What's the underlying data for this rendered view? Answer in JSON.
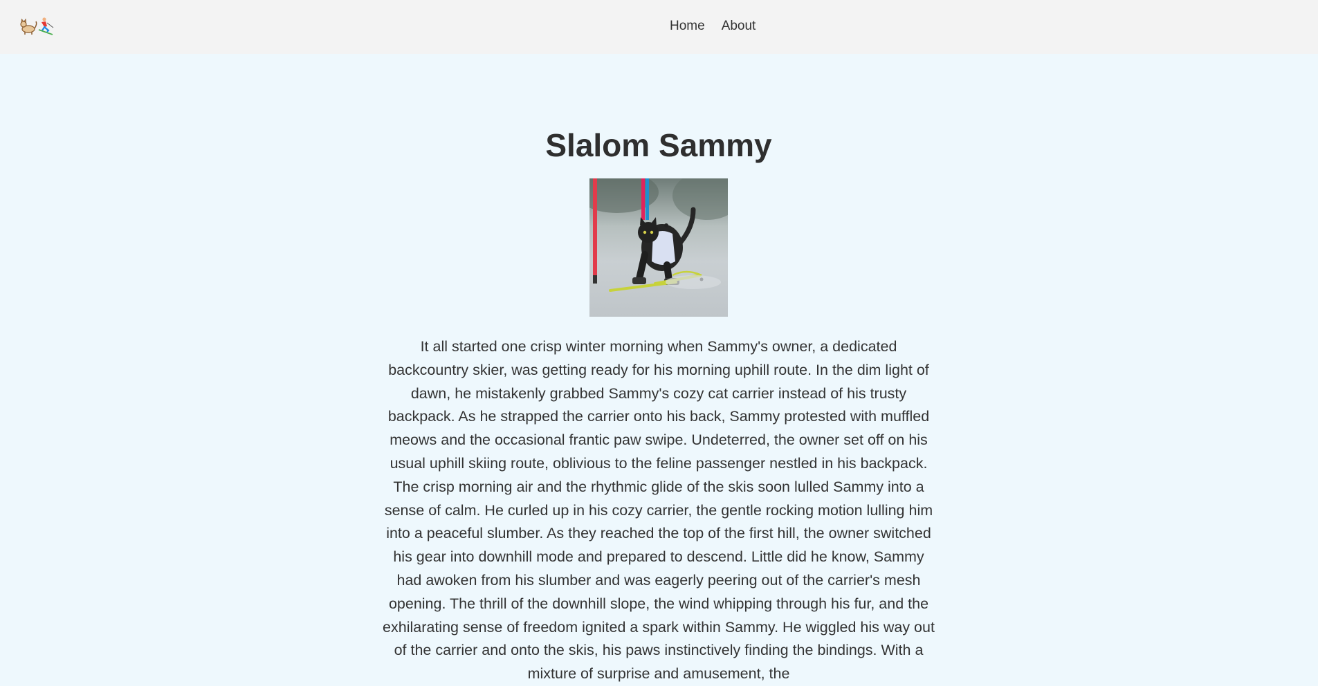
{
  "header": {
    "logo_emoji": "🐈⛷️",
    "nav": [
      {
        "label": "Home"
      },
      {
        "label": "About"
      }
    ]
  },
  "main": {
    "title": "Slalom Sammy",
    "image_name": "cat-skiing-slalom-photo",
    "story": "It all started one crisp winter morning when Sammy's owner, a dedicated backcountry skier, was getting ready for his morning uphill route. In the dim light of dawn, he mistakenly grabbed Sammy's cozy cat carrier instead of his trusty backpack. As he strapped the carrier onto his back, Sammy protested with muffled meows and the occasional frantic paw swipe. Undeterred, the owner set off on his usual uphill skiing route, oblivious to the feline passenger nestled in his backpack. The crisp morning air and the rhythmic glide of the skis soon lulled Sammy into a sense of calm. He curled up in his cozy carrier, the gentle rocking motion lulling him into a peaceful slumber. As they reached the top of the first hill, the owner switched his gear into downhill mode and prepared to descend. Little did he know, Sammy had awoken from his slumber and was eagerly peering out of the carrier's mesh opening. The thrill of the downhill slope, the wind whipping through his fur, and the exhilarating sense of freedom ignited a spark within Sammy. He wiggled his way out of the carrier and onto the skis, his paws instinctively finding the bindings. With a mixture of surprise and amusement, the"
  }
}
